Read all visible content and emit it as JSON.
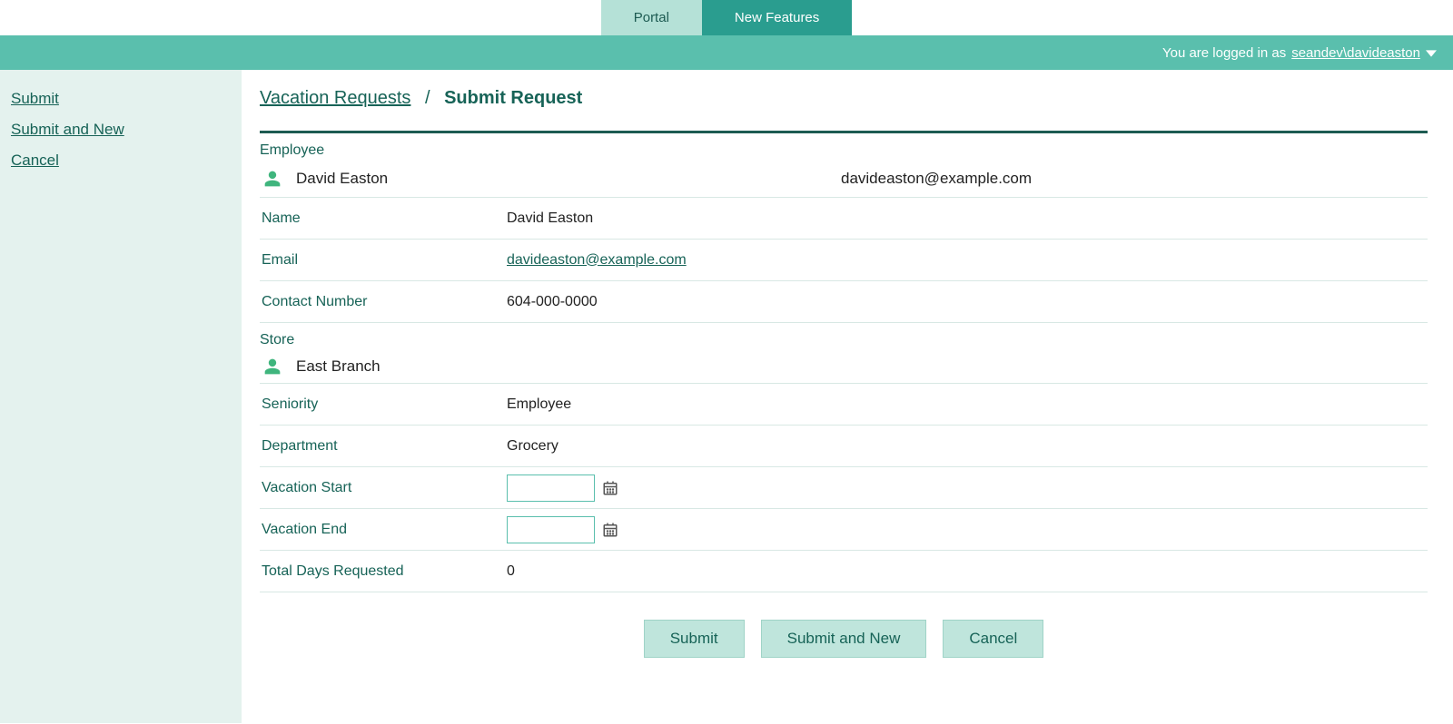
{
  "top_tabs": {
    "portal": "Portal",
    "new_features": "New Features"
  },
  "login_bar": {
    "prefix": "You are logged in as",
    "username": "seandev\\davideaston"
  },
  "sidebar": {
    "submit": "Submit",
    "submit_and_new": "Submit and New",
    "cancel": "Cancel"
  },
  "breadcrumb": {
    "parent": "Vacation Requests",
    "sep": "/",
    "current": "Submit Request"
  },
  "employee_section": {
    "label": "Employee",
    "name": "David Easton",
    "email": "davideaston@example.com"
  },
  "fields": {
    "name": {
      "label": "Name",
      "value": "David Easton"
    },
    "email": {
      "label": "Email",
      "value": "davideaston@example.com"
    },
    "contact": {
      "label": "Contact Number",
      "value": "604-000-0000"
    },
    "store": {
      "label": "Store",
      "value": "East Branch"
    },
    "seniority": {
      "label": "Seniority",
      "value": "Employee"
    },
    "department": {
      "label": "Department",
      "value": "Grocery"
    },
    "vacation_start": {
      "label": "Vacation Start",
      "value": ""
    },
    "vacation_end": {
      "label": "Vacation End",
      "value": ""
    },
    "total_days": {
      "label": "Total Days Requested",
      "value": "0"
    }
  },
  "buttons": {
    "submit": "Submit",
    "submit_and_new": "Submit and New",
    "cancel": "Cancel"
  }
}
